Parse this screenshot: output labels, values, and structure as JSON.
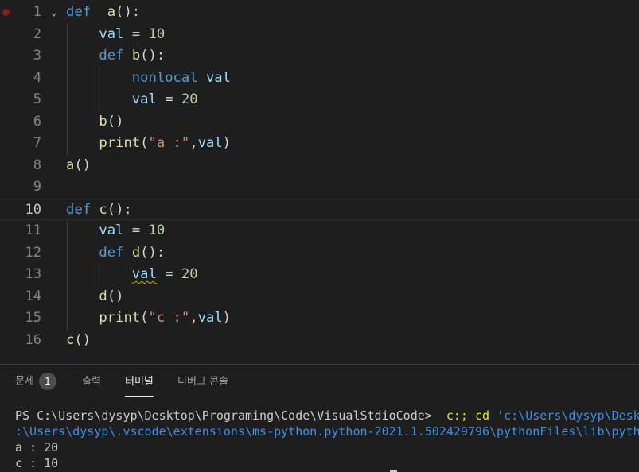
{
  "editor": {
    "lines": [
      {
        "n": "1",
        "tokens": [
          [
            "kw",
            "def"
          ],
          [
            "",
            "  "
          ],
          [
            "fn",
            "a"
          ],
          [
            "",
            "():"
          ]
        ]
      },
      {
        "n": "2",
        "tokens": [
          [
            "",
            "    "
          ],
          [
            "var",
            "val"
          ],
          [
            "",
            " = "
          ],
          [
            "num",
            "10"
          ]
        ]
      },
      {
        "n": "3",
        "tokens": [
          [
            "",
            "    "
          ],
          [
            "kw",
            "def"
          ],
          [
            "",
            " "
          ],
          [
            "fn",
            "b"
          ],
          [
            "",
            "():"
          ]
        ]
      },
      {
        "n": "4",
        "tokens": [
          [
            "",
            "        "
          ],
          [
            "kw",
            "nonlocal"
          ],
          [
            "",
            " "
          ],
          [
            "var",
            "val"
          ]
        ]
      },
      {
        "n": "5",
        "tokens": [
          [
            "",
            "        "
          ],
          [
            "var",
            "val"
          ],
          [
            "",
            " = "
          ],
          [
            "num",
            "20"
          ]
        ]
      },
      {
        "n": "6",
        "tokens": [
          [
            "",
            "    "
          ],
          [
            "fn",
            "b"
          ],
          [
            "",
            "()"
          ]
        ]
      },
      {
        "n": "7",
        "tokens": [
          [
            "",
            "    "
          ],
          [
            "fn",
            "print"
          ],
          [
            "",
            "("
          ],
          [
            "str",
            "\"a :\""
          ],
          [
            "",
            ","
          ],
          [
            "var",
            "val"
          ],
          [
            "",
            ")"
          ]
        ]
      },
      {
        "n": "8",
        "tokens": [
          [
            "fn",
            "a"
          ],
          [
            "",
            "()"
          ]
        ]
      },
      {
        "n": "9",
        "tokens": []
      },
      {
        "n": "10",
        "tokens": [
          [
            "kw",
            "def"
          ],
          [
            "",
            " "
          ],
          [
            "fn",
            "c"
          ],
          [
            "",
            "():"
          ]
        ]
      },
      {
        "n": "11",
        "tokens": [
          [
            "",
            "    "
          ],
          [
            "var",
            "val"
          ],
          [
            "",
            " = "
          ],
          [
            "num",
            "10"
          ]
        ]
      },
      {
        "n": "12",
        "tokens": [
          [
            "",
            "    "
          ],
          [
            "kw",
            "def"
          ],
          [
            "",
            " "
          ],
          [
            "fn",
            "d"
          ],
          [
            "",
            "():"
          ]
        ]
      },
      {
        "n": "13",
        "tokens": [
          [
            "",
            "        "
          ],
          [
            "var squig",
            "val"
          ],
          [
            "",
            " = "
          ],
          [
            "num",
            "20"
          ]
        ]
      },
      {
        "n": "14",
        "tokens": [
          [
            "",
            "    "
          ],
          [
            "fn",
            "d"
          ],
          [
            "",
            "()"
          ]
        ]
      },
      {
        "n": "15",
        "tokens": [
          [
            "",
            "    "
          ],
          [
            "fn",
            "print"
          ],
          [
            "",
            "("
          ],
          [
            "str",
            "\"c :\""
          ],
          [
            "",
            ","
          ],
          [
            "var",
            "val"
          ],
          [
            "",
            ")"
          ]
        ]
      },
      {
        "n": "16",
        "tokens": [
          [
            "fn",
            "c"
          ],
          [
            "",
            "()"
          ]
        ]
      }
    ],
    "active_line": "10",
    "breakpoint_line": "1",
    "fold_icon": "chevron-down-icon"
  },
  "panel": {
    "tabs": {
      "problems": "문제",
      "problems_count": "1",
      "output": "출력",
      "terminal": "터미널",
      "debug_console": "디버그 콘솔"
    },
    "active_tab": "terminal",
    "terminal_lines": [
      [
        [
          "",
          "PS C:\\Users\\dysyp\\Desktop\\Programing\\Code\\VisualStdioCode>  "
        ],
        [
          "t-yellow",
          "c:; cd"
        ],
        [
          "",
          " "
        ],
        [
          "t-blue",
          "'c:\\Users\\dysyp\\Desktop\\Programing\\Code\\VisualStdioCode'"
        ]
      ],
      [
        [
          "t-blue",
          ":\\Users\\dysyp\\.vscode\\extensions\\ms-python.python-2021.1.502429796\\pythonFiles\\lib\\python\\debugpy\\launcher'"
        ]
      ],
      [
        [
          "",
          "a : 20"
        ]
      ],
      [
        [
          "",
          "c : 10"
        ]
      ]
    ]
  },
  "colors": {
    "keyword": "#569cd6",
    "function": "#dcdcaa",
    "variable": "#9cdcfe",
    "number": "#b5cea8",
    "string": "#ce9178",
    "breakpoint": "#8a1b1b",
    "background": "#1e1e1e"
  }
}
